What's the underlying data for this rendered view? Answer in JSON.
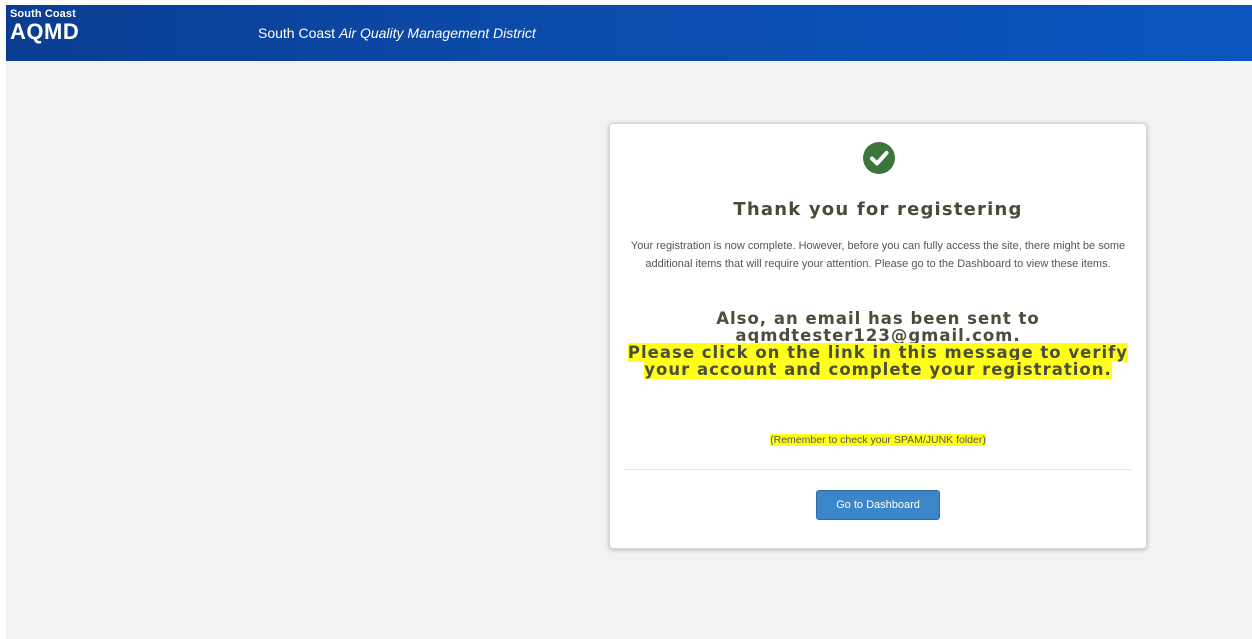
{
  "header": {
    "logo_small": "South Coast",
    "logo_big": "AQMD",
    "title_plain": "South Coast",
    "title_italic": "Air Quality Management District"
  },
  "card": {
    "icon": "check-circle-icon",
    "title": "Thank you for registering",
    "body": "Your registration is now complete. However, before you can fully access the site, there might be some additional items that will require your attention. Please go to the Dashboard to view these items.",
    "email_line1": "Also, an email has been sent to",
    "email_line2": "aqmdtester123@gmail.com.",
    "verify_text": "Please click on the link in this message to verify your account and complete your registration.",
    "note": "(Remember to check your SPAM/JUNK folder)",
    "button_label": "Go to Dashboard"
  },
  "colors": {
    "header_blue": "#0b4aa8",
    "check_green": "#3c763d",
    "highlight": "#ffff1a",
    "button_blue": "#3a86c8"
  }
}
